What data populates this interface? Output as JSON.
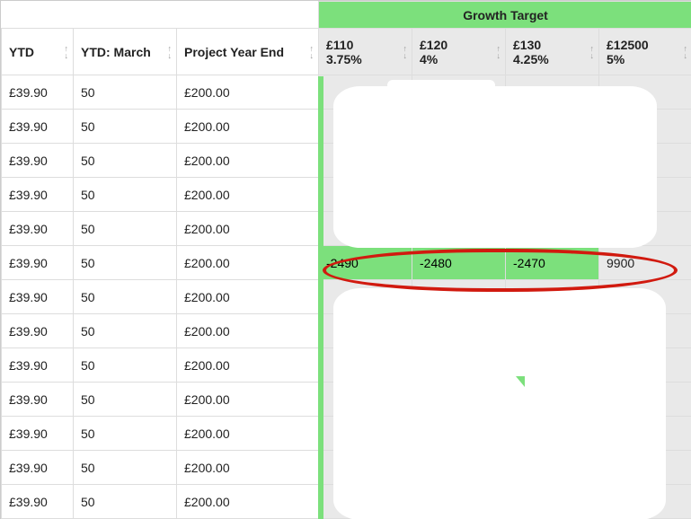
{
  "headers": {
    "growth_title": "Growth Target",
    "ytd": "YTD",
    "ytd_march": "YTD: March",
    "pye": "Project Year End",
    "gt": [
      {
        "amount": "£110",
        "pct": "3.75%"
      },
      {
        "amount": "£120",
        "pct": "4%"
      },
      {
        "amount": "£130",
        "pct": "4.25%"
      },
      {
        "amount": "£12500",
        "pct": "5%"
      }
    ]
  },
  "rows": [
    {
      "ytd": "£39.90",
      "march": "50",
      "pye": "£200.00",
      "gt": [
        "",
        "",
        "",
        ""
      ]
    },
    {
      "ytd": "£39.90",
      "march": "50",
      "pye": "£200.00",
      "gt": [
        "",
        "",
        "",
        ""
      ]
    },
    {
      "ytd": "£39.90",
      "march": "50",
      "pye": "£200.00",
      "gt": [
        "",
        "",
        "",
        ""
      ]
    },
    {
      "ytd": "£39.90",
      "march": "50",
      "pye": "£200.00",
      "gt": [
        "",
        "",
        "",
        ""
      ]
    },
    {
      "ytd": "£39.90",
      "march": "50",
      "pye": "£200.00",
      "gt": [
        "",
        "",
        "",
        ""
      ]
    },
    {
      "ytd": "£39.90",
      "march": "50",
      "pye": "£200.00",
      "gt": [
        "-2490",
        "-2480",
        "-2470",
        "9900"
      ]
    },
    {
      "ytd": "£39.90",
      "march": "50",
      "pye": "£200.00",
      "gt": [
        "",
        "",
        "",
        ""
      ]
    },
    {
      "ytd": "£39.90",
      "march": "50",
      "pye": "£200.00",
      "gt": [
        "",
        "",
        "",
        ""
      ]
    },
    {
      "ytd": "£39.90",
      "march": "50",
      "pye": "£200.00",
      "gt": [
        "",
        "",
        "",
        ""
      ]
    },
    {
      "ytd": "£39.90",
      "march": "50",
      "pye": "£200.00",
      "gt": [
        "",
        "",
        "",
        ""
      ]
    },
    {
      "ytd": "£39.90",
      "march": "50",
      "pye": "£200.00",
      "gt": [
        "",
        "",
        "",
        ""
      ]
    },
    {
      "ytd": "£39.90",
      "march": "50",
      "pye": "£200.00",
      "gt": [
        "",
        "",
        "",
        ""
      ]
    },
    {
      "ytd": "£39.90",
      "march": "50",
      "pye": "£200.00",
      "gt": [
        "",
        "",
        "",
        ""
      ]
    }
  ]
}
